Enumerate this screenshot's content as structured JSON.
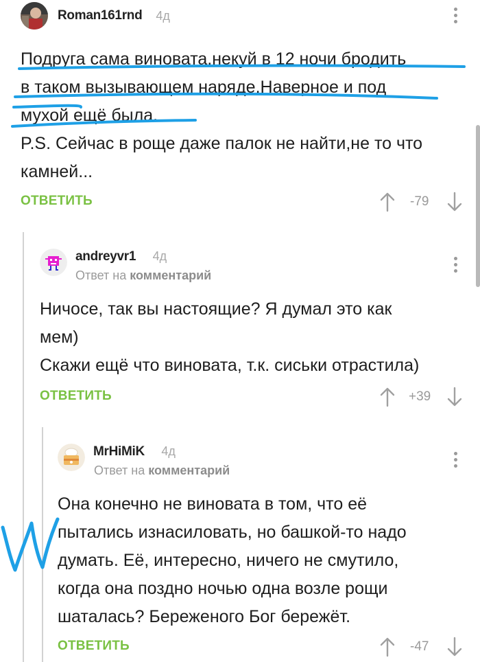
{
  "comments": [
    {
      "username": "Roman161rnd",
      "time": "4д",
      "lines": [
        "Подруга сама виновата,некуй в 12 ночи бродить",
        "в таком вызывающем наряде.Наверное и под",
        "мухой ещё была.",
        "P.S. Сейчас в роще даже палок не найти,не то что",
        "камней..."
      ],
      "reply_label": "ОТВЕТИТЬ",
      "rating": "-79"
    },
    {
      "username": "andreyvr1",
      "time": "4д",
      "reply_to_prefix": "Ответ на",
      "reply_to_link": "комментарий",
      "lines": [
        "Ничосе, так вы настоящие? Я думал это как",
        "мем)",
        "Скажи ещё что виновата, т.к. сиськи отрастила)"
      ],
      "reply_label": "ОТВЕТИТЬ",
      "rating": "+39"
    },
    {
      "username": "MrHiMiK",
      "time": "4д",
      "reply_to_prefix": "Ответ на",
      "reply_to_link": "комментарий",
      "lines": [
        "Она конечно не виновата в том, что её",
        "пытались изнасиловать, но башкой-то надо",
        "думать. Её, интересно, ничего не смутило,",
        "когда она поздно ночью одна возле рощи",
        "шаталась? Береженого Бог бережёт."
      ],
      "reply_label": "ОТВЕТИТЬ",
      "rating": "-47"
    }
  ],
  "colors": {
    "accent_green": "#7ac143",
    "annotation_blue": "#1ea0e6",
    "muted_gray": "#9a9a9a"
  },
  "icons": [
    "avatar-photo",
    "avatar-pink-robot",
    "avatar-cake",
    "more-vert-icon",
    "arrow-up-icon",
    "arrow-down-icon"
  ]
}
